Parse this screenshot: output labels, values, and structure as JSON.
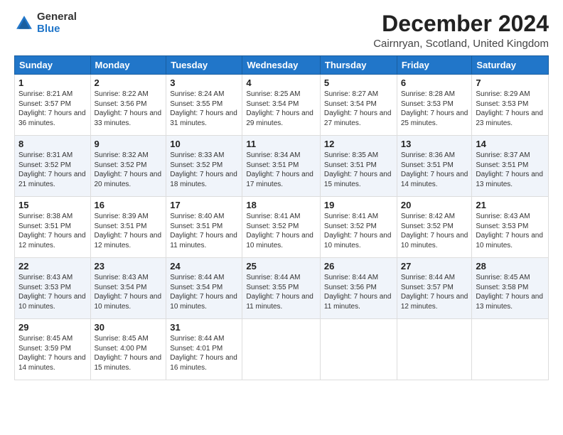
{
  "logo": {
    "general": "General",
    "blue": "Blue"
  },
  "header": {
    "month": "December 2024",
    "location": "Cairnryan, Scotland, United Kingdom"
  },
  "days_of_week": [
    "Sunday",
    "Monday",
    "Tuesday",
    "Wednesday",
    "Thursday",
    "Friday",
    "Saturday"
  ],
  "weeks": [
    [
      {
        "day": "1",
        "sunrise": "8:21 AM",
        "sunset": "3:57 PM",
        "daylight": "7 hours and 36 minutes."
      },
      {
        "day": "2",
        "sunrise": "8:22 AM",
        "sunset": "3:56 PM",
        "daylight": "7 hours and 33 minutes."
      },
      {
        "day": "3",
        "sunrise": "8:24 AM",
        "sunset": "3:55 PM",
        "daylight": "7 hours and 31 minutes."
      },
      {
        "day": "4",
        "sunrise": "8:25 AM",
        "sunset": "3:54 PM",
        "daylight": "7 hours and 29 minutes."
      },
      {
        "day": "5",
        "sunrise": "8:27 AM",
        "sunset": "3:54 PM",
        "daylight": "7 hours and 27 minutes."
      },
      {
        "day": "6",
        "sunrise": "8:28 AM",
        "sunset": "3:53 PM",
        "daylight": "7 hours and 25 minutes."
      },
      {
        "day": "7",
        "sunrise": "8:29 AM",
        "sunset": "3:53 PM",
        "daylight": "7 hours and 23 minutes."
      }
    ],
    [
      {
        "day": "8",
        "sunrise": "8:31 AM",
        "sunset": "3:52 PM",
        "daylight": "7 hours and 21 minutes."
      },
      {
        "day": "9",
        "sunrise": "8:32 AM",
        "sunset": "3:52 PM",
        "daylight": "7 hours and 20 minutes."
      },
      {
        "day": "10",
        "sunrise": "8:33 AM",
        "sunset": "3:52 PM",
        "daylight": "7 hours and 18 minutes."
      },
      {
        "day": "11",
        "sunrise": "8:34 AM",
        "sunset": "3:51 PM",
        "daylight": "7 hours and 17 minutes."
      },
      {
        "day": "12",
        "sunrise": "8:35 AM",
        "sunset": "3:51 PM",
        "daylight": "7 hours and 15 minutes."
      },
      {
        "day": "13",
        "sunrise": "8:36 AM",
        "sunset": "3:51 PM",
        "daylight": "7 hours and 14 minutes."
      },
      {
        "day": "14",
        "sunrise": "8:37 AM",
        "sunset": "3:51 PM",
        "daylight": "7 hours and 13 minutes."
      }
    ],
    [
      {
        "day": "15",
        "sunrise": "8:38 AM",
        "sunset": "3:51 PM",
        "daylight": "7 hours and 12 minutes."
      },
      {
        "day": "16",
        "sunrise": "8:39 AM",
        "sunset": "3:51 PM",
        "daylight": "7 hours and 12 minutes."
      },
      {
        "day": "17",
        "sunrise": "8:40 AM",
        "sunset": "3:51 PM",
        "daylight": "7 hours and 11 minutes."
      },
      {
        "day": "18",
        "sunrise": "8:41 AM",
        "sunset": "3:52 PM",
        "daylight": "7 hours and 10 minutes."
      },
      {
        "day": "19",
        "sunrise": "8:41 AM",
        "sunset": "3:52 PM",
        "daylight": "7 hours and 10 minutes."
      },
      {
        "day": "20",
        "sunrise": "8:42 AM",
        "sunset": "3:52 PM",
        "daylight": "7 hours and 10 minutes."
      },
      {
        "day": "21",
        "sunrise": "8:43 AM",
        "sunset": "3:53 PM",
        "daylight": "7 hours and 10 minutes."
      }
    ],
    [
      {
        "day": "22",
        "sunrise": "8:43 AM",
        "sunset": "3:53 PM",
        "daylight": "7 hours and 10 minutes."
      },
      {
        "day": "23",
        "sunrise": "8:43 AM",
        "sunset": "3:54 PM",
        "daylight": "7 hours and 10 minutes."
      },
      {
        "day": "24",
        "sunrise": "8:44 AM",
        "sunset": "3:54 PM",
        "daylight": "7 hours and 10 minutes."
      },
      {
        "day": "25",
        "sunrise": "8:44 AM",
        "sunset": "3:55 PM",
        "daylight": "7 hours and 11 minutes."
      },
      {
        "day": "26",
        "sunrise": "8:44 AM",
        "sunset": "3:56 PM",
        "daylight": "7 hours and 11 minutes."
      },
      {
        "day": "27",
        "sunrise": "8:44 AM",
        "sunset": "3:57 PM",
        "daylight": "7 hours and 12 minutes."
      },
      {
        "day": "28",
        "sunrise": "8:45 AM",
        "sunset": "3:58 PM",
        "daylight": "7 hours and 13 minutes."
      }
    ],
    [
      {
        "day": "29",
        "sunrise": "8:45 AM",
        "sunset": "3:59 PM",
        "daylight": "7 hours and 14 minutes."
      },
      {
        "day": "30",
        "sunrise": "8:45 AM",
        "sunset": "4:00 PM",
        "daylight": "7 hours and 15 minutes."
      },
      {
        "day": "31",
        "sunrise": "8:44 AM",
        "sunset": "4:01 PM",
        "daylight": "7 hours and 16 minutes."
      },
      null,
      null,
      null,
      null
    ]
  ],
  "labels": {
    "sunrise": "Sunrise:",
    "sunset": "Sunset:",
    "daylight": "Daylight:"
  }
}
